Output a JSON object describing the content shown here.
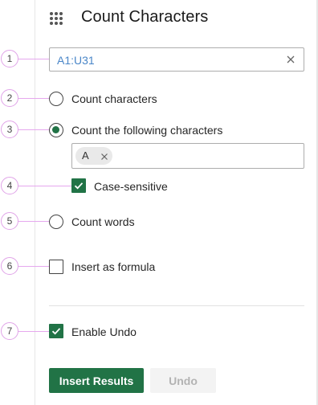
{
  "header": {
    "title": "Count Characters",
    "icon": "grip-icon"
  },
  "markers": [
    "1",
    "2",
    "3",
    "4",
    "5",
    "6",
    "7"
  ],
  "range": {
    "value": "A1:U31",
    "clear_icon": "close-icon"
  },
  "options": {
    "count_characters": {
      "label": "Count characters",
      "selected": false
    },
    "count_following": {
      "label": "Count the following characters",
      "selected": true
    },
    "count_words": {
      "label": "Count words",
      "selected": false
    }
  },
  "characters": {
    "chips": [
      {
        "label": "A",
        "remove_icon": "close-icon"
      }
    ]
  },
  "case_sensitive": {
    "label": "Case-sensitive",
    "checked": true
  },
  "insert_formula": {
    "label": "Insert as formula",
    "checked": false
  },
  "enable_undo": {
    "label": "Enable Undo",
    "checked": true
  },
  "buttons": {
    "insert_results": "Insert Results",
    "undo": "Undo"
  },
  "colors": {
    "accent": "#217346",
    "range_text": "#4a86c8",
    "marker_border": "#e0a3e8",
    "disabled_bg": "#f3f3f3",
    "disabled_text": "#b3b3b3"
  }
}
